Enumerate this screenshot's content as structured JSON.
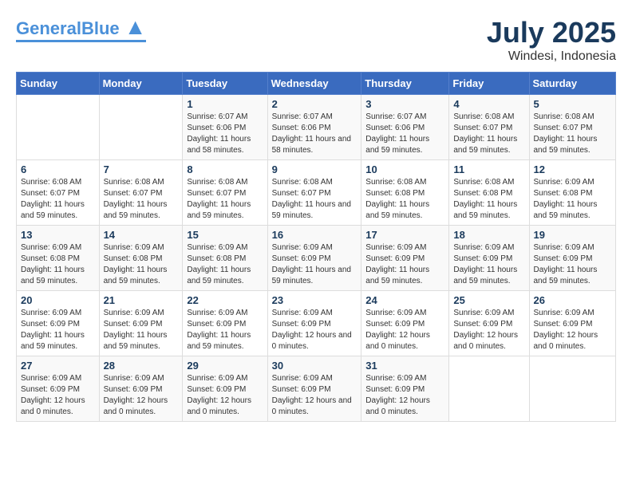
{
  "header": {
    "logo_general": "General",
    "logo_blue": "Blue",
    "month_year": "July 2025",
    "location": "Windesi, Indonesia"
  },
  "days_of_week": [
    "Sunday",
    "Monday",
    "Tuesday",
    "Wednesday",
    "Thursday",
    "Friday",
    "Saturday"
  ],
  "weeks": [
    [
      {
        "day": "",
        "info": ""
      },
      {
        "day": "",
        "info": ""
      },
      {
        "day": "1",
        "sunrise": "Sunrise: 6:07 AM",
        "sunset": "Sunset: 6:06 PM",
        "daylight": "Daylight: 11 hours and 58 minutes."
      },
      {
        "day": "2",
        "sunrise": "Sunrise: 6:07 AM",
        "sunset": "Sunset: 6:06 PM",
        "daylight": "Daylight: 11 hours and 58 minutes."
      },
      {
        "day": "3",
        "sunrise": "Sunrise: 6:07 AM",
        "sunset": "Sunset: 6:06 PM",
        "daylight": "Daylight: 11 hours and 59 minutes."
      },
      {
        "day": "4",
        "sunrise": "Sunrise: 6:08 AM",
        "sunset": "Sunset: 6:07 PM",
        "daylight": "Daylight: 11 hours and 59 minutes."
      },
      {
        "day": "5",
        "sunrise": "Sunrise: 6:08 AM",
        "sunset": "Sunset: 6:07 PM",
        "daylight": "Daylight: 11 hours and 59 minutes."
      }
    ],
    [
      {
        "day": "6",
        "sunrise": "Sunrise: 6:08 AM",
        "sunset": "Sunset: 6:07 PM",
        "daylight": "Daylight: 11 hours and 59 minutes."
      },
      {
        "day": "7",
        "sunrise": "Sunrise: 6:08 AM",
        "sunset": "Sunset: 6:07 PM",
        "daylight": "Daylight: 11 hours and 59 minutes."
      },
      {
        "day": "8",
        "sunrise": "Sunrise: 6:08 AM",
        "sunset": "Sunset: 6:07 PM",
        "daylight": "Daylight: 11 hours and 59 minutes."
      },
      {
        "day": "9",
        "sunrise": "Sunrise: 6:08 AM",
        "sunset": "Sunset: 6:07 PM",
        "daylight": "Daylight: 11 hours and 59 minutes."
      },
      {
        "day": "10",
        "sunrise": "Sunrise: 6:08 AM",
        "sunset": "Sunset: 6:08 PM",
        "daylight": "Daylight: 11 hours and 59 minutes."
      },
      {
        "day": "11",
        "sunrise": "Sunrise: 6:08 AM",
        "sunset": "Sunset: 6:08 PM",
        "daylight": "Daylight: 11 hours and 59 minutes."
      },
      {
        "day": "12",
        "sunrise": "Sunrise: 6:09 AM",
        "sunset": "Sunset: 6:08 PM",
        "daylight": "Daylight: 11 hours and 59 minutes."
      }
    ],
    [
      {
        "day": "13",
        "sunrise": "Sunrise: 6:09 AM",
        "sunset": "Sunset: 6:08 PM",
        "daylight": "Daylight: 11 hours and 59 minutes."
      },
      {
        "day": "14",
        "sunrise": "Sunrise: 6:09 AM",
        "sunset": "Sunset: 6:08 PM",
        "daylight": "Daylight: 11 hours and 59 minutes."
      },
      {
        "day": "15",
        "sunrise": "Sunrise: 6:09 AM",
        "sunset": "Sunset: 6:08 PM",
        "daylight": "Daylight: 11 hours and 59 minutes."
      },
      {
        "day": "16",
        "sunrise": "Sunrise: 6:09 AM",
        "sunset": "Sunset: 6:09 PM",
        "daylight": "Daylight: 11 hours and 59 minutes."
      },
      {
        "day": "17",
        "sunrise": "Sunrise: 6:09 AM",
        "sunset": "Sunset: 6:09 PM",
        "daylight": "Daylight: 11 hours and 59 minutes."
      },
      {
        "day": "18",
        "sunrise": "Sunrise: 6:09 AM",
        "sunset": "Sunset: 6:09 PM",
        "daylight": "Daylight: 11 hours and 59 minutes."
      },
      {
        "day": "19",
        "sunrise": "Sunrise: 6:09 AM",
        "sunset": "Sunset: 6:09 PM",
        "daylight": "Daylight: 11 hours and 59 minutes."
      }
    ],
    [
      {
        "day": "20",
        "sunrise": "Sunrise: 6:09 AM",
        "sunset": "Sunset: 6:09 PM",
        "daylight": "Daylight: 11 hours and 59 minutes."
      },
      {
        "day": "21",
        "sunrise": "Sunrise: 6:09 AM",
        "sunset": "Sunset: 6:09 PM",
        "daylight": "Daylight: 11 hours and 59 minutes."
      },
      {
        "day": "22",
        "sunrise": "Sunrise: 6:09 AM",
        "sunset": "Sunset: 6:09 PM",
        "daylight": "Daylight: 11 hours and 59 minutes."
      },
      {
        "day": "23",
        "sunrise": "Sunrise: 6:09 AM",
        "sunset": "Sunset: 6:09 PM",
        "daylight": "Daylight: 12 hours and 0 minutes."
      },
      {
        "day": "24",
        "sunrise": "Sunrise: 6:09 AM",
        "sunset": "Sunset: 6:09 PM",
        "daylight": "Daylight: 12 hours and 0 minutes."
      },
      {
        "day": "25",
        "sunrise": "Sunrise: 6:09 AM",
        "sunset": "Sunset: 6:09 PM",
        "daylight": "Daylight: 12 hours and 0 minutes."
      },
      {
        "day": "26",
        "sunrise": "Sunrise: 6:09 AM",
        "sunset": "Sunset: 6:09 PM",
        "daylight": "Daylight: 12 hours and 0 minutes."
      }
    ],
    [
      {
        "day": "27",
        "sunrise": "Sunrise: 6:09 AM",
        "sunset": "Sunset: 6:09 PM",
        "daylight": "Daylight: 12 hours and 0 minutes."
      },
      {
        "day": "28",
        "sunrise": "Sunrise: 6:09 AM",
        "sunset": "Sunset: 6:09 PM",
        "daylight": "Daylight: 12 hours and 0 minutes."
      },
      {
        "day": "29",
        "sunrise": "Sunrise: 6:09 AM",
        "sunset": "Sunset: 6:09 PM",
        "daylight": "Daylight: 12 hours and 0 minutes."
      },
      {
        "day": "30",
        "sunrise": "Sunrise: 6:09 AM",
        "sunset": "Sunset: 6:09 PM",
        "daylight": "Daylight: 12 hours and 0 minutes."
      },
      {
        "day": "31",
        "sunrise": "Sunrise: 6:09 AM",
        "sunset": "Sunset: 6:09 PM",
        "daylight": "Daylight: 12 hours and 0 minutes."
      },
      {
        "day": "",
        "info": ""
      },
      {
        "day": "",
        "info": ""
      }
    ]
  ]
}
